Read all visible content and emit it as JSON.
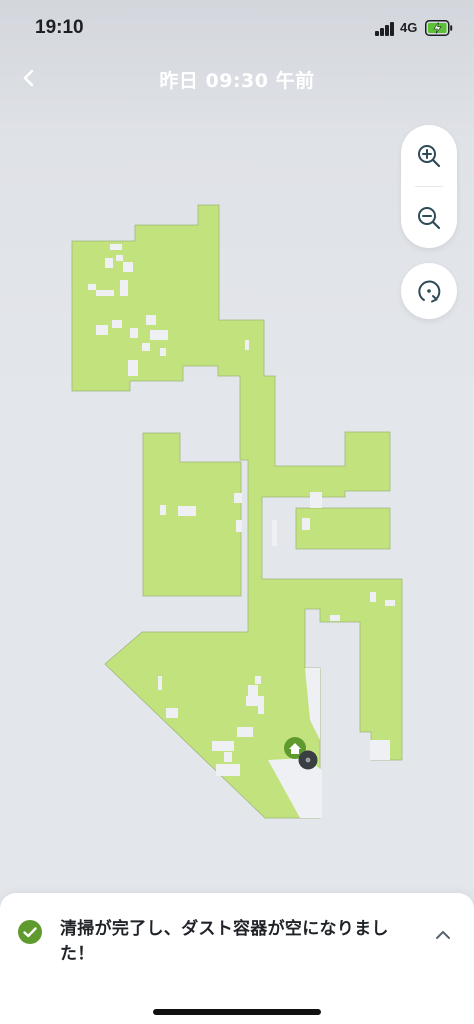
{
  "status_bar": {
    "time": "19:10",
    "network": "4G",
    "battery_state": "charging",
    "accent_battery": "#5bc236"
  },
  "header": {
    "title": "昨日 09:30 午前",
    "back_icon": "chevron-left-icon"
  },
  "map_controls": {
    "zoom_in_icon": "zoom-in-icon",
    "zoom_out_icon": "zoom-out-icon",
    "rotate_icon": "rotate-icon"
  },
  "map": {
    "cleaned_color": "#c2e27e",
    "uncleaned_color": "#eef0f3",
    "dock_color": "#5e9a2e",
    "robot_color": "#3a3d42"
  },
  "notification": {
    "message": "清掃が完了し、ダスト容器が空になりました！",
    "icon": "check-circle-icon",
    "expand_icon": "chevron-up-icon",
    "accent": "#5e9a2e"
  }
}
